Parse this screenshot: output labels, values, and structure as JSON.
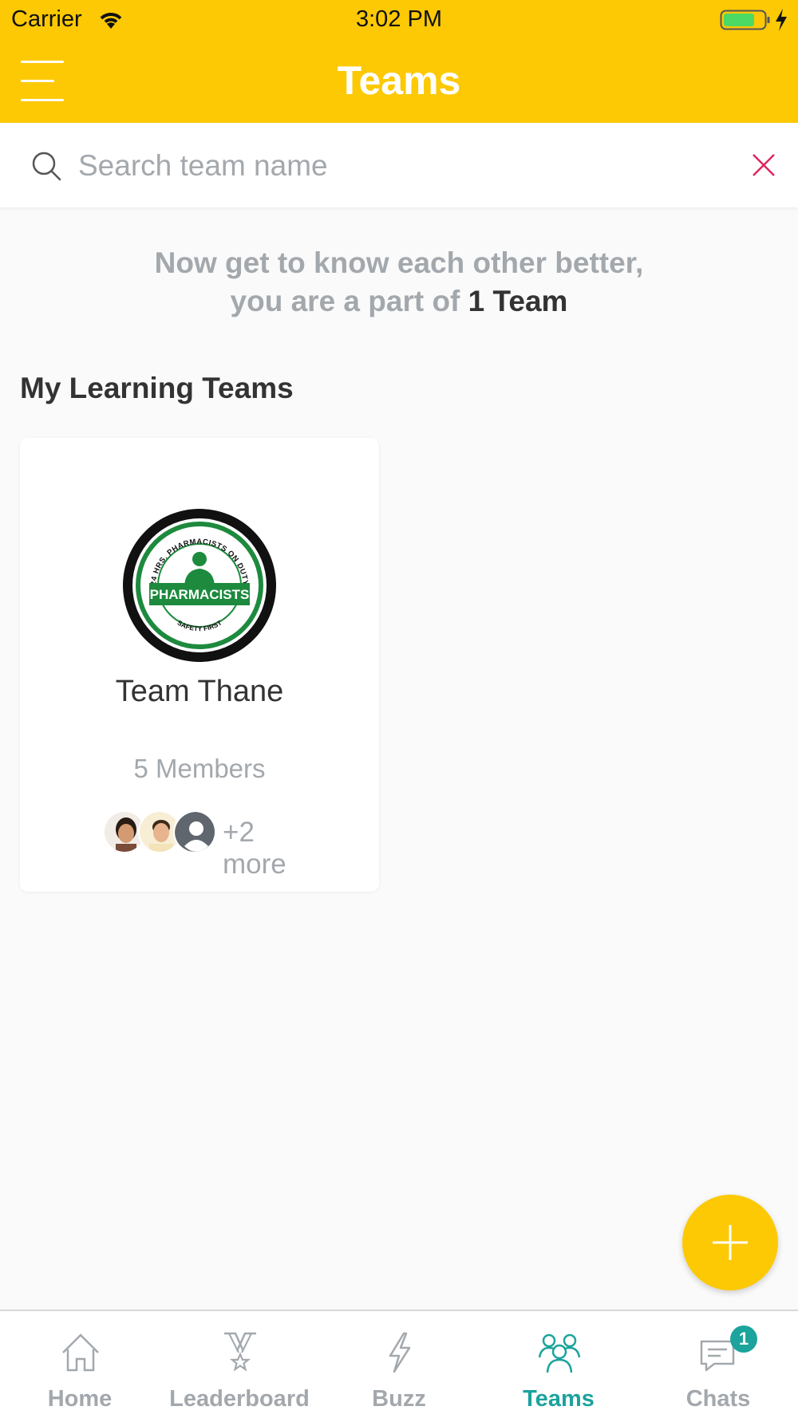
{
  "status_bar": {
    "carrier": "Carrier",
    "time": "3:02 PM"
  },
  "header": {
    "title": "Teams"
  },
  "search": {
    "placeholder": "Search team name",
    "value": ""
  },
  "intro": {
    "line1": "Now get to know each other better,",
    "line2_prefix": "you are a part of",
    "line2_count": "1 Team"
  },
  "section": {
    "title": "My Learning Teams"
  },
  "teams": [
    {
      "name": "Team Thane",
      "members": "5 Members",
      "more": "+2 more",
      "logo": {
        "label": "PHARMACISTS",
        "top_arc": "24 HRS. PHARMACISTS ON DUTY",
        "bottom_arc": "SAFETY FIRST"
      }
    }
  ],
  "tabs": [
    {
      "label": "Home",
      "icon": "home-icon"
    },
    {
      "label": "Leaderboard",
      "icon": "medal-icon"
    },
    {
      "label": "Buzz",
      "icon": "lightning-icon"
    },
    {
      "label": "Teams",
      "icon": "teams-icon",
      "active": true
    },
    {
      "label": "Chats",
      "icon": "chat-icon",
      "badge": "1"
    }
  ],
  "colors": {
    "brand": "#fcc904",
    "accent": "#1ba39c",
    "muted": "#a3a8ad",
    "clear": "#e0245e"
  }
}
